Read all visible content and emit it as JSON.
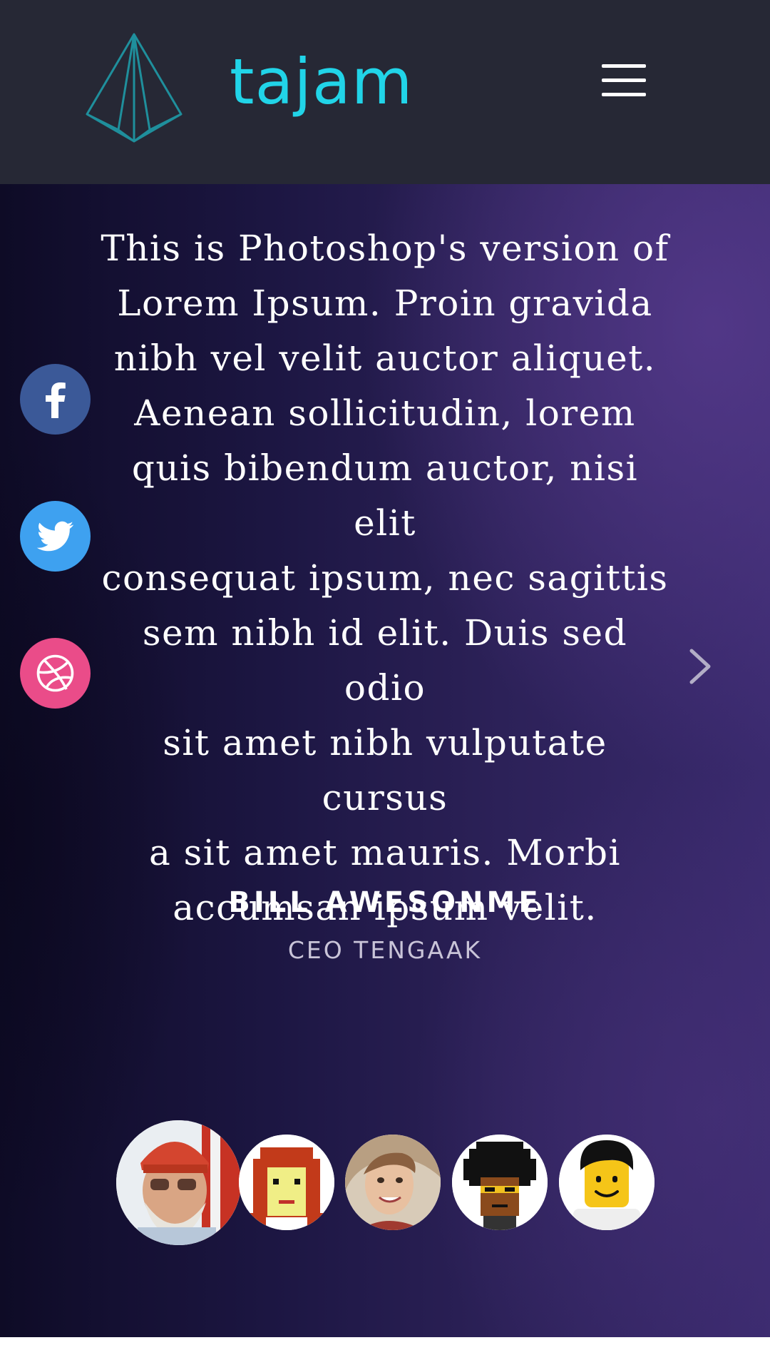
{
  "header": {
    "brand": "tajam",
    "logo_icon": "paper-plane-icon",
    "menu_icon": "hamburger-menu-icon"
  },
  "testimonial": {
    "quote_lines": [
      "This is Photoshop's version of",
      "Lorem Ipsum. Proin gravida",
      "nibh vel velit auctor aliquet.",
      "Aenean sollicitudin, lorem",
      "quis bibendum auctor, nisi elit",
      "consequat ipsum, nec sagittis",
      "sem nibh id elit. Duis sed odio",
      "sit amet nibh vulputate cursus",
      "a sit amet mauris. Morbi",
      "accumsan ipsum velit."
    ],
    "author_name": "BILL AWESONME",
    "author_title": "CEO TENGAAK",
    "next_icon": "chevron-right-icon"
  },
  "social": [
    {
      "name": "facebook",
      "icon": "facebook-icon",
      "color": "#3b5998"
    },
    {
      "name": "twitter",
      "icon": "twitter-icon",
      "color": "#3ea1f0"
    },
    {
      "name": "dribbble",
      "icon": "dribbble-icon",
      "color": "#ea4c89"
    }
  ],
  "avatars": [
    {
      "name": "avatar-man-red-cap",
      "selected": true
    },
    {
      "name": "avatar-pixel-redhead"
    },
    {
      "name": "avatar-smiling-woman"
    },
    {
      "name": "avatar-pixel-afro"
    },
    {
      "name": "avatar-lego-figure"
    }
  ],
  "colors": {
    "header_bg": "#262835",
    "brand": "#21d4e8",
    "hero_dark": "#0e0b26",
    "hero_light": "#3a2a6e"
  }
}
